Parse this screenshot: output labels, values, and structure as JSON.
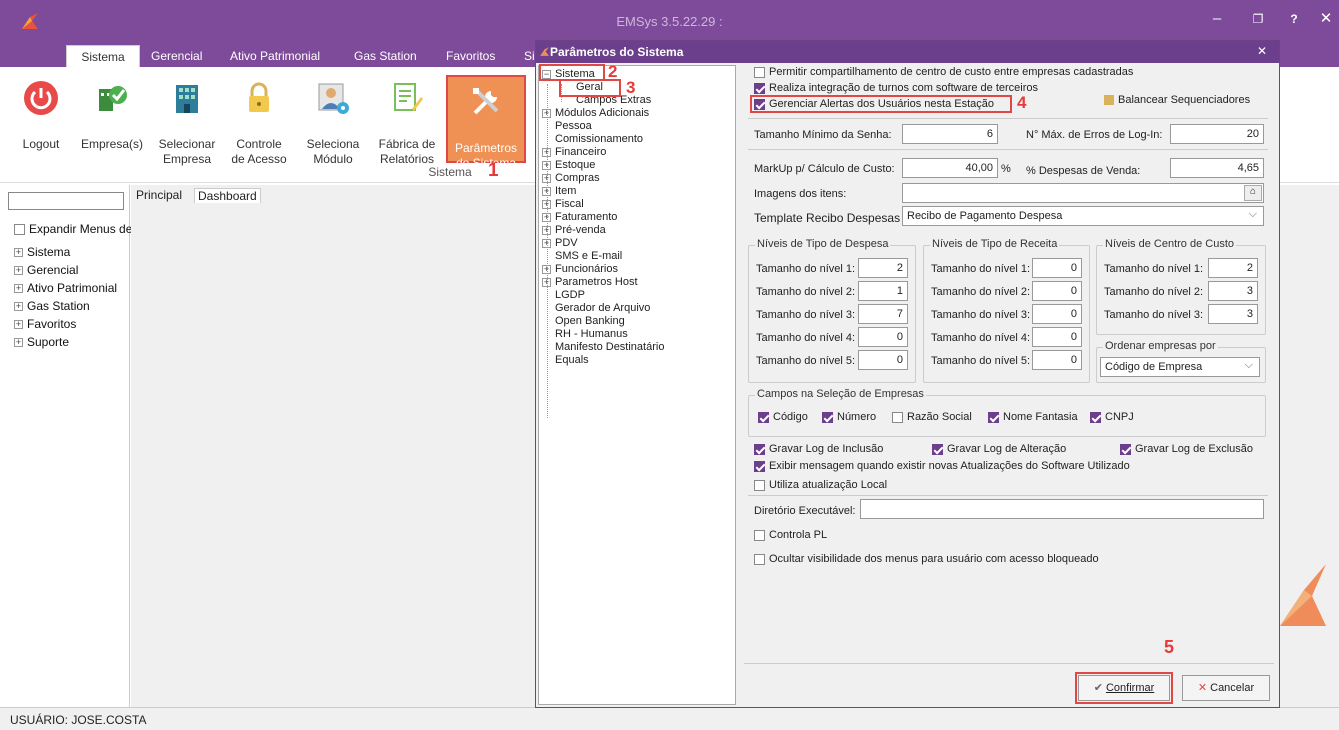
{
  "app": {
    "title": "EMSys 3.5.22.29 :",
    "window_buttons": [
      "–",
      "❐",
      "?",
      "✕"
    ]
  },
  "ribbon": {
    "tabs": [
      "Sistema",
      "Gerencial",
      "Ativo Patrimonial",
      "Gas Station",
      "Favoritos",
      "Si"
    ],
    "buttons": [
      {
        "l1": "Logout",
        "l2": "",
        "icon": "power-icon"
      },
      {
        "l1": "Empresa(s)",
        "l2": "",
        "icon": "company-check-icon"
      },
      {
        "l1": "Selecionar",
        "l2": "Empresa",
        "icon": "building-icon"
      },
      {
        "l1": "Controle",
        "l2": "de Acesso",
        "icon": "lock-icon"
      },
      {
        "l1": "Seleciona",
        "l2": "Módulo",
        "icon": "user-gear-icon"
      },
      {
        "l1": "Fábrica de",
        "l2": "Relatórios",
        "icon": "report-icon"
      },
      {
        "l1": "Parâmetros",
        "l2": "do Sistema",
        "icon": "tools-icon"
      }
    ],
    "group": "Sistema"
  },
  "annotations": [
    "1",
    "2",
    "3",
    "4",
    "5"
  ],
  "leftnav": {
    "expand": "Expandir Menus de",
    "items": [
      "Sistema",
      "Gerencial",
      "Ativo Patrimonial",
      "Gas Station",
      "Favoritos",
      "Suporte"
    ]
  },
  "main": {
    "tabs": [
      "Principal",
      "Dashboard"
    ]
  },
  "status": "USUÁRIO: JOSE.COSTA",
  "dialog": {
    "title": "Parâmetros do Sistema",
    "close": "✕",
    "tree": [
      {
        "label": "Sistema",
        "exp": "minus",
        "lvl": 0
      },
      {
        "label": "Geral",
        "exp": "",
        "lvl": 1
      },
      {
        "label": "Campos Extras",
        "exp": "",
        "lvl": 1
      },
      {
        "label": "Módulos Adicionais",
        "exp": "plus",
        "lvl": 0
      },
      {
        "label": "Pessoa",
        "exp": "",
        "lvl": 0
      },
      {
        "label": "Comissionamento",
        "exp": "",
        "lvl": 0
      },
      {
        "label": "Financeiro",
        "exp": "plus",
        "lvl": 0
      },
      {
        "label": "Estoque",
        "exp": "plus",
        "lvl": 0
      },
      {
        "label": "Compras",
        "exp": "plus",
        "lvl": 0
      },
      {
        "label": "Item",
        "exp": "plus",
        "lvl": 0
      },
      {
        "label": "Fiscal",
        "exp": "plus",
        "lvl": 0
      },
      {
        "label": "Faturamento",
        "exp": "plus",
        "lvl": 0
      },
      {
        "label": "Pré-venda",
        "exp": "plus",
        "lvl": 0
      },
      {
        "label": "PDV",
        "exp": "plus",
        "lvl": 0
      },
      {
        "label": "SMS e E-mail",
        "exp": "",
        "lvl": 0
      },
      {
        "label": "Funcionários",
        "exp": "plus",
        "lvl": 0
      },
      {
        "label": "Parametros Host",
        "exp": "plus",
        "lvl": 0
      },
      {
        "label": "LGDP",
        "exp": "",
        "lvl": 0
      },
      {
        "label": "Gerador de Arquivo",
        "exp": "",
        "lvl": 0
      },
      {
        "label": "Open Banking",
        "exp": "",
        "lvl": 0
      },
      {
        "label": "RH - Humanus",
        "exp": "",
        "lvl": 0
      },
      {
        "label": "Manifesto Destinatário",
        "exp": "",
        "lvl": 0
      },
      {
        "label": "Equals",
        "exp": "",
        "lvl": 0
      }
    ],
    "checks_top": [
      {
        "label": "Permitir compartilhamento de centro de custo entre empresas cadastradas",
        "checked": false
      },
      {
        "label": "Realiza integração de turnos com software de terceiros",
        "checked": true
      },
      {
        "label": "Gerenciar Alertas dos Usuários nesta Estação",
        "checked": true
      }
    ],
    "balancear": "Balancear Sequenciadores",
    "senha_label": "Tamanho Mínimo da Senha:",
    "senha_value": "6",
    "erros_label": "N° Máx. de Erros de Log-In:",
    "erros_value": "20",
    "markup_label": "MarkUp p/ Cálculo de Custo:",
    "markup_value": "40,00",
    "pct": "%",
    "despesas_label": "% Despesas de Venda:",
    "despesas_value": "4,65",
    "imagens_label": "Imagens dos itens:",
    "template_label": "Template Recibo Despesas",
    "template_value": "Recibo de Pagamento Despesa",
    "grp_despesa": {
      "title": "Níveis de Tipo de Despesa",
      "labels": [
        "Tamanho do nível 1:",
        "Tamanho do nível 2:",
        "Tamanho do nível 3:",
        "Tamanho do nível 4:",
        "Tamanho do nível 5:"
      ],
      "values": [
        "2",
        "1",
        "7",
        "0",
        "0"
      ]
    },
    "grp_receita": {
      "title": "Níveis de Tipo de Receita",
      "labels": [
        "Tamanho do nível 1:",
        "Tamanho do nível 2:",
        "Tamanho do nível 3:",
        "Tamanho do nível 4:",
        "Tamanho do nível 5:"
      ],
      "values": [
        "0",
        "0",
        "0",
        "0",
        "0"
      ]
    },
    "grp_centro": {
      "title": "Níveis de Centro de Custo",
      "labels": [
        "Tamanho do nível 1:",
        "Tamanho do nível 2:",
        "Tamanho do nível 3:"
      ],
      "values": [
        "2",
        "3",
        "3"
      ]
    },
    "ordenar": {
      "title": "Ordenar empresas por",
      "value": "Código de Empresa"
    },
    "campos": {
      "title": "Campos na Seleção de Empresas",
      "items": [
        {
          "label": "Código",
          "checked": true
        },
        {
          "label": "Número",
          "checked": true
        },
        {
          "label": "Razão Social",
          "checked": false
        },
        {
          "label": "Nome Fantasia",
          "checked": true
        },
        {
          "label": "CNPJ",
          "checked": true
        }
      ]
    },
    "log_checks": [
      {
        "label": "Gravar Log de Inclusão",
        "checked": true
      },
      {
        "label": "Gravar Log de Alteração",
        "checked": true
      },
      {
        "label": "Gravar Log de Exclusão",
        "checked": true
      }
    ],
    "checks_bottom": [
      {
        "label": "Exibir mensagem quando existir novas Atualizações do Software Utilizado",
        "checked": true
      },
      {
        "label": "Utiliza atualização Local",
        "checked": false
      }
    ],
    "diretorio_label": "Diretório Executável:",
    "diretorio_value": "",
    "controla_pl": {
      "label": "Controla PL",
      "checked": false
    },
    "ocultar": {
      "label": "Ocultar visibilidade dos menus para usuário com acesso bloqueado",
      "checked": false
    },
    "confirm": "Confirmar",
    "cancel": "Cancelar"
  },
  "colors": {
    "brand": "#7e4b9a",
    "highlight": "#e04848",
    "selected": "#ef9154"
  }
}
